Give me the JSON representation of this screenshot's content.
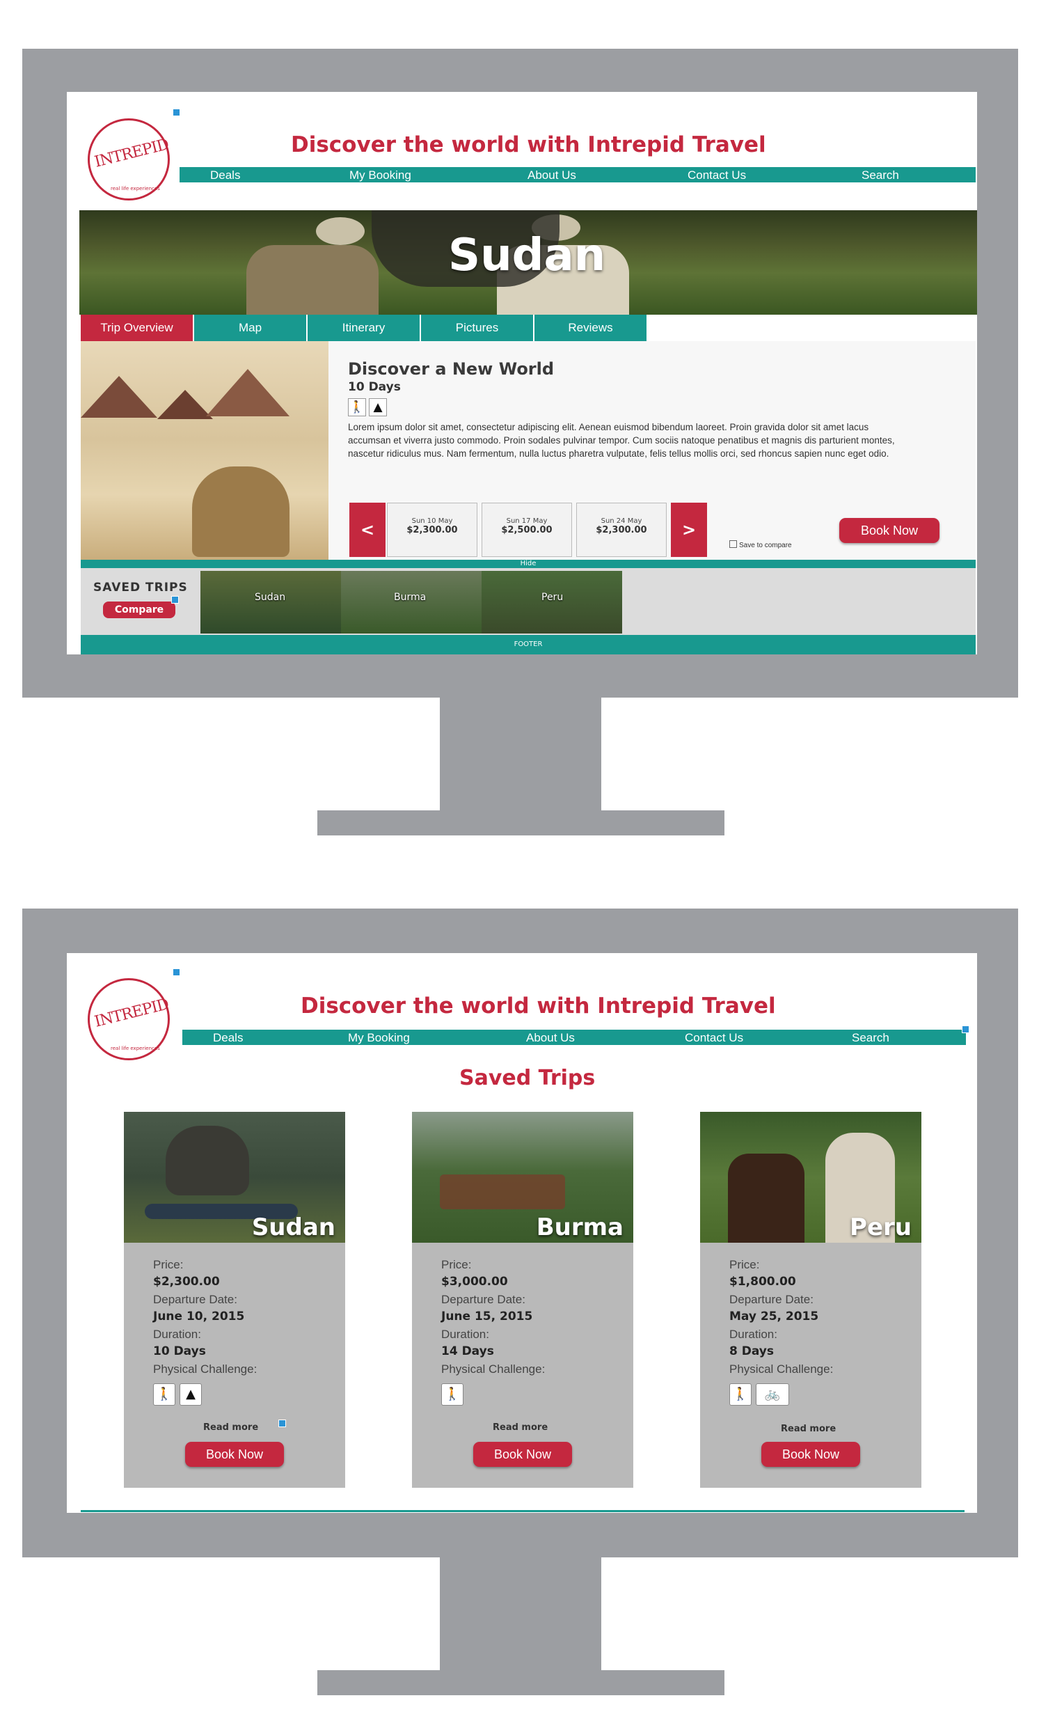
{
  "colors": {
    "frame": "#9c9ea2",
    "brand_red": "#c4283f",
    "teal": "#18998f",
    "card_gray": "#b9b9b9",
    "accent_blue": "#2a94d6"
  },
  "logo": {
    "text": "INTREPID",
    "tagline": "real life experiences"
  },
  "header": {
    "headline": "Discover the world with Intrepid Travel"
  },
  "nav": {
    "items": [
      "Deals",
      "My Booking",
      "About Us",
      "Contact Us",
      "Search"
    ]
  },
  "screen1": {
    "hero_title": "Sudan",
    "tabs": [
      "Trip Overview",
      "Map",
      "Itinerary",
      "Pictures",
      "Reviews"
    ],
    "content": {
      "title": "Discover a New World",
      "duration": "10 Days",
      "icons": [
        "hiking-icon",
        "camping-icon"
      ],
      "body": "Lorem ipsum dolor sit amet, consectetur adipiscing elit. Aenean euismod bibendum laoreet. Proin gravida dolor sit amet lacus accumsan et viverra justo commodo. Proin sodales pulvinar tempor. Cum sociis natoque penatibus et magnis dis parturient montes, nascetur ridiculus mus. Nam fermentum, nulla luctus pharetra vulputate, felis tellus mollis orci, sed rhoncus sapien nunc eget odio."
    },
    "dates": [
      {
        "date": "Sun 10 May",
        "price": "$2,300.00"
      },
      {
        "date": "Sun 17 May",
        "price": "$2,500.00"
      },
      {
        "date": "Sun 24 May",
        "price": "$2,300.00"
      }
    ],
    "prev_arrow": "<",
    "next_arrow": ">",
    "save_to_compare": "Save to compare",
    "book_now": "Book Now",
    "hide": "Hide",
    "saved_trips_label": "SAVED TRIPS",
    "compare": "Compare",
    "saved_thumbs": [
      "Sudan",
      "Burma",
      "Peru"
    ],
    "footer": "FOOTER"
  },
  "screen2": {
    "heading": "Saved Trips",
    "labels": {
      "price": "Price:",
      "departure": "Departure Date:",
      "duration": "Duration:",
      "challenge": "Physical Challenge:"
    },
    "read_more": "Read more",
    "book_now": "Book Now",
    "cards": [
      {
        "name": "Sudan",
        "price": "$2,300.00",
        "departure": "June 10, 2015",
        "duration": "10 Days",
        "icons": [
          "hiking-icon",
          "camping-icon"
        ]
      },
      {
        "name": "Burma",
        "price": "$3,000.00",
        "departure": "June 15, 2015",
        "duration": "14 Days",
        "icons": [
          "hiking-icon"
        ]
      },
      {
        "name": "Peru",
        "price": "$1,800.00",
        "departure": "May 25, 2015",
        "duration": "8 Days",
        "icons": [
          "hiking-icon",
          "cycling-icon"
        ]
      }
    ]
  }
}
